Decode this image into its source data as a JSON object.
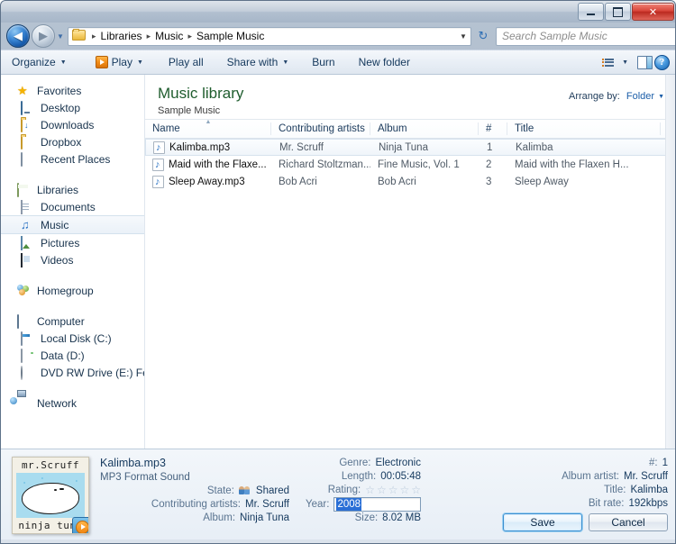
{
  "window": {
    "controls": {
      "minimize": "minimize-button",
      "maximize": "maximize-button",
      "close": "✕"
    }
  },
  "address_bar": {
    "back_glyph": "◀",
    "forward_glyph": "▶",
    "history_caret": "▼",
    "folder_icon": "folder-icon",
    "breadcrumbs": [
      "Libraries",
      "Music",
      "Sample Music"
    ],
    "separator": "▸",
    "dropdown_caret": "▼",
    "refresh_glyph": "↻"
  },
  "search": {
    "placeholder": "Search Sample Music",
    "icon": "search-icon"
  },
  "toolbar": {
    "items": [
      {
        "label": "Organize",
        "caret": "▼",
        "has_icon": false
      },
      {
        "label": "Play",
        "caret": "▼",
        "has_icon": true
      },
      {
        "label": "Play all",
        "caret": "",
        "has_icon": false
      },
      {
        "label": "Share with",
        "caret": "▼",
        "has_icon": false
      },
      {
        "label": "Burn",
        "caret": "",
        "has_icon": false
      },
      {
        "label": "New folder",
        "caret": "",
        "has_icon": false
      }
    ],
    "view_caret": "▼"
  },
  "sidebar": {
    "sections": [
      {
        "root": {
          "label": "Favorites",
          "icon": "star-icon"
        },
        "items": [
          {
            "label": "Desktop",
            "icon": "desktop-icon"
          },
          {
            "label": "Downloads",
            "icon": "downloads-folder-icon"
          },
          {
            "label": "Dropbox",
            "icon": "dropbox-folder-icon"
          },
          {
            "label": "Recent Places",
            "icon": "recent-places-icon"
          }
        ]
      },
      {
        "root": {
          "label": "Libraries",
          "icon": "libraries-icon"
        },
        "items": [
          {
            "label": "Documents",
            "icon": "documents-icon"
          },
          {
            "label": "Music",
            "icon": "music-note-icon",
            "selected": true
          },
          {
            "label": "Pictures",
            "icon": "pictures-icon"
          },
          {
            "label": "Videos",
            "icon": "videos-icon"
          }
        ]
      },
      {
        "root": {
          "label": "Homegroup",
          "icon": "homegroup-icon"
        },
        "items": []
      },
      {
        "root": {
          "label": "Computer",
          "icon": "computer-icon"
        },
        "items": [
          {
            "label": "Local Disk (C:)",
            "icon": "hard-disk-icon"
          },
          {
            "label": "Data (D:)",
            "icon": "drive-icon"
          },
          {
            "label": "DVD RW Drive (E:) Fe",
            "icon": "dvd-drive-icon"
          }
        ]
      },
      {
        "root": {
          "label": "Network",
          "icon": "network-icon"
        },
        "items": []
      }
    ]
  },
  "library": {
    "title": "Music library",
    "subtitle": "Sample Music",
    "arrange_label": "Arrange by:",
    "arrange_value": "Folder",
    "arrange_caret": "▼",
    "sort_indicator": "▲"
  },
  "file_list": {
    "columns": [
      "Name",
      "Contributing artists",
      "Album",
      "#",
      "Title"
    ],
    "rows": [
      {
        "name": "Kalimba.mp3",
        "artists": "Mr. Scruff",
        "album": "Ninja Tuna",
        "track": "1",
        "title": "Kalimba",
        "selected": true
      },
      {
        "name": "Maid with the Flaxe...",
        "artists": "Richard Stoltzman...",
        "album": "Fine Music, Vol. 1",
        "track": "2",
        "title": "Maid with the Flaxen H...",
        "selected": false
      },
      {
        "name": "Sleep Away.mp3",
        "artists": "Bob Acri",
        "album": "Bob Acri",
        "track": "3",
        "title": "Sleep Away",
        "selected": false
      }
    ]
  },
  "details_pane": {
    "album_art": {
      "top_text": "mr.Scruff",
      "bottom_text": "ninja tuna",
      "play_badge": "play-overlay-icon"
    },
    "file_name": "Kalimba.mp3",
    "file_type": "MP3 Format Sound",
    "left_fields": [
      {
        "label": "State:",
        "value": "Shared",
        "icon": "shared-users-icon"
      },
      {
        "label": "Contributing artists:",
        "value": "Mr. Scruff"
      },
      {
        "label": "Album:",
        "value": "Ninja Tuna"
      }
    ],
    "mid_fields": [
      {
        "label": "Genre:",
        "value": "Electronic"
      },
      {
        "label": "Length:",
        "value": "00:05:48"
      },
      {
        "label": "Rating:",
        "value": "",
        "stars": 5,
        "filled": 0,
        "star_glyph": "☆"
      },
      {
        "label": "Year:",
        "value": "2008",
        "editing": true
      },
      {
        "label": "Size:",
        "value": "8.02 MB"
      }
    ],
    "right_fields": [
      {
        "label": "#:",
        "value": "1"
      },
      {
        "label": "Album artist:",
        "value": "Mr. Scruff"
      },
      {
        "label": "Title:",
        "value": "Kalimba"
      },
      {
        "label": "Bit rate:",
        "value": "192kbps"
      }
    ],
    "save_label": "Save",
    "cancel_label": "Cancel"
  },
  "colors": {
    "accent": "#2a6fd6",
    "library_title": "#1f5d2e",
    "link": "#1b5ea8",
    "close_button": "#d8453a"
  }
}
